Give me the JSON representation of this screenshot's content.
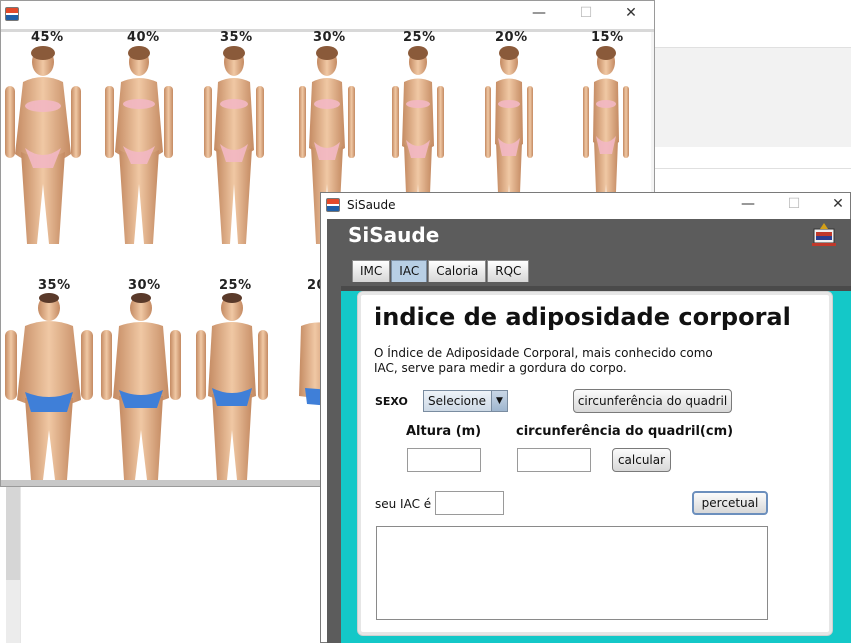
{
  "back_window": {
    "controls": {
      "minimize": "—",
      "maximize": "☐",
      "close": "✕"
    },
    "women_percentages": [
      "45%",
      "40%",
      "35%",
      "30%",
      "25%",
      "20%",
      "15%"
    ],
    "men_percentages": [
      "35%",
      "30%",
      "25%",
      "20%"
    ]
  },
  "front_window": {
    "title": "SiSaude",
    "controls": {
      "minimize": "—",
      "maximize": "☐",
      "close": "✕"
    },
    "app_name": "SiSaude",
    "tabs": [
      {
        "label": "IMC",
        "active": false
      },
      {
        "label": "IAC",
        "active": true
      },
      {
        "label": "Caloria",
        "active": false
      },
      {
        "label": "RQC",
        "active": false
      }
    ],
    "heading": "indice de adiposidade corporal",
    "description": "O Índice de Adiposidade Corporal, mais conhecido como IAC, serve para medir a gordura do corpo.",
    "sexo_label": "SEXO",
    "sexo_select": {
      "value": "Selecione"
    },
    "quadril_button": "circunferência do quadril",
    "altura_label": "Altura (m)",
    "quadril_label": "circunferência do quadril(cm)",
    "altura_value": "",
    "quadril_value": "",
    "calcular_button": "calcular",
    "result_label": "seu IAC é",
    "result_value": "",
    "percentual_button": "percetual",
    "output_text": ""
  },
  "colors": {
    "teal": "#14c8c8",
    "header": "#5c5c5c",
    "active_tab": "#b8cfe5"
  }
}
